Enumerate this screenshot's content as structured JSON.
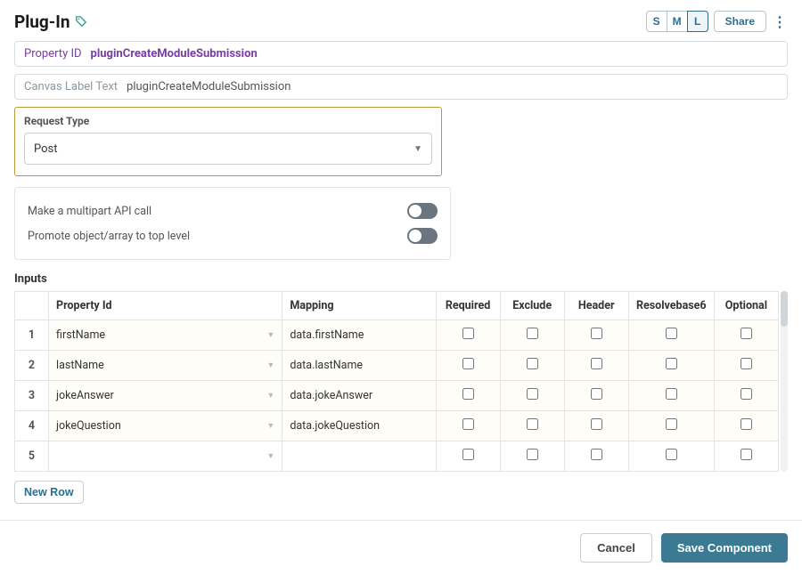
{
  "header": {
    "title": "Plug-In",
    "size_buttons": {
      "s": "S",
      "m": "M",
      "l": "L",
      "active": "L"
    },
    "share_label": "Share"
  },
  "property_bar": {
    "label": "Property ID",
    "value": "pluginCreateModuleSubmission"
  },
  "canvas_bar": {
    "label": "Canvas Label Text",
    "value": "pluginCreateModuleSubmission"
  },
  "request": {
    "label": "Request Type",
    "selected": "Post"
  },
  "toggles": {
    "multipart_label": "Make a multipart API call",
    "promote_label": "Promote object/array to top level"
  },
  "inputs": {
    "section_label": "Inputs",
    "columns": {
      "property_id": "Property Id",
      "mapping": "Mapping",
      "required": "Required",
      "exclude": "Exclude",
      "header": "Header",
      "resolvebase6": "Resolvebase6",
      "optional": "Optional"
    },
    "rows": [
      {
        "num": "1",
        "property_id": "firstName",
        "mapping": "data.firstName"
      },
      {
        "num": "2",
        "property_id": "lastName",
        "mapping": "data.lastName"
      },
      {
        "num": "3",
        "property_id": "jokeAnswer",
        "mapping": "data.jokeAnswer"
      },
      {
        "num": "4",
        "property_id": "jokeQuestion",
        "mapping": "data.jokeQuestion"
      },
      {
        "num": "5",
        "property_id": "",
        "mapping": ""
      }
    ],
    "new_row_label": "New Row"
  },
  "footer": {
    "cancel": "Cancel",
    "save": "Save Component"
  }
}
